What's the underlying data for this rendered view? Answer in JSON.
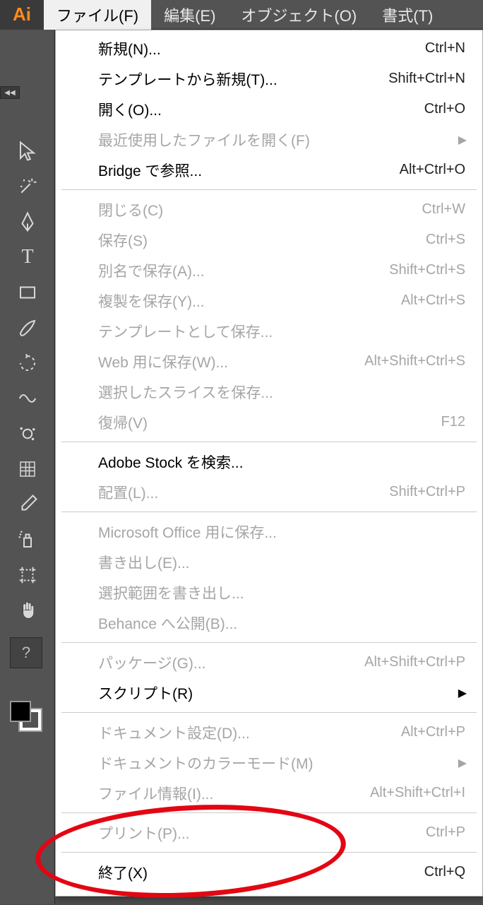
{
  "logo": "Ai",
  "menubar": {
    "file": "ファイル(F)",
    "edit": "編集(E)",
    "object": "オブジェクト(O)",
    "type": "書式(T)"
  },
  "collapse": "◀◀",
  "help_glyph": "?",
  "tools": {
    "selection": "selection",
    "wand": "magic-wand",
    "pen": "pen",
    "type": "T",
    "rect": "rectangle",
    "paint": "paintbrush",
    "rotate": "rotate",
    "warp": "warp",
    "eyedrop_sym": "symbol-sprayer",
    "mesh": "mesh",
    "eyedrop": "eyedropper",
    "spray": "spray",
    "artboard": "artboard",
    "hand": "hand"
  },
  "file_menu": [
    {
      "label": "新規(N)...",
      "shortcut": "Ctrl+N",
      "enabled": true
    },
    {
      "label": "テンプレートから新規(T)...",
      "shortcut": "Shift+Ctrl+N",
      "enabled": true
    },
    {
      "label": "開く(O)...",
      "shortcut": "Ctrl+O",
      "enabled": true
    },
    {
      "label": "最近使用したファイルを開く(F)",
      "shortcut": "",
      "enabled": false,
      "submenu": true
    },
    {
      "label": "Bridge で参照...",
      "shortcut": "Alt+Ctrl+O",
      "enabled": true
    },
    {
      "sep": true
    },
    {
      "label": "閉じる(C)",
      "shortcut": "Ctrl+W",
      "enabled": false
    },
    {
      "label": "保存(S)",
      "shortcut": "Ctrl+S",
      "enabled": false
    },
    {
      "label": "別名で保存(A)...",
      "shortcut": "Shift+Ctrl+S",
      "enabled": false
    },
    {
      "label": "複製を保存(Y)...",
      "shortcut": "Alt+Ctrl+S",
      "enabled": false
    },
    {
      "label": "テンプレートとして保存...",
      "shortcut": "",
      "enabled": false
    },
    {
      "label": "Web 用に保存(W)...",
      "shortcut": "Alt+Shift+Ctrl+S",
      "enabled": false
    },
    {
      "label": "選択したスライスを保存...",
      "shortcut": "",
      "enabled": false
    },
    {
      "label": "復帰(V)",
      "shortcut": "F12",
      "enabled": false
    },
    {
      "sep": true
    },
    {
      "label": "Adobe Stock を検索...",
      "shortcut": "",
      "enabled": true
    },
    {
      "label": "配置(L)...",
      "shortcut": "Shift+Ctrl+P",
      "enabled": false
    },
    {
      "sep": true
    },
    {
      "label": "Microsoft Office 用に保存...",
      "shortcut": "",
      "enabled": false
    },
    {
      "label": "書き出し(E)...",
      "shortcut": "",
      "enabled": false
    },
    {
      "label": "選択範囲を書き出し...",
      "shortcut": "",
      "enabled": false
    },
    {
      "label": "Behance へ公開(B)...",
      "shortcut": "",
      "enabled": false
    },
    {
      "sep": true
    },
    {
      "label": "パッケージ(G)...",
      "shortcut": "Alt+Shift+Ctrl+P",
      "enabled": false
    },
    {
      "label": "スクリプト(R)",
      "shortcut": "",
      "enabled": true,
      "submenu": true
    },
    {
      "sep": true
    },
    {
      "label": "ドキュメント設定(D)...",
      "shortcut": "Alt+Ctrl+P",
      "enabled": false
    },
    {
      "label": "ドキュメントのカラーモード(M)",
      "shortcut": "",
      "enabled": false,
      "submenu": true
    },
    {
      "label": "ファイル情報(I)...",
      "shortcut": "Alt+Shift+Ctrl+I",
      "enabled": false
    },
    {
      "sep": true
    },
    {
      "label": "プリント(P)...",
      "shortcut": "Ctrl+P",
      "enabled": false
    },
    {
      "sep": true
    },
    {
      "label": "終了(X)",
      "shortcut": "Ctrl+Q",
      "enabled": true
    }
  ]
}
